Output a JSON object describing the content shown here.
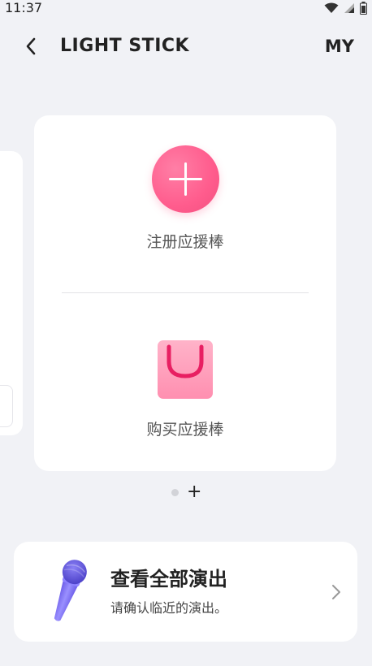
{
  "status_bar": {
    "time": "11:37"
  },
  "header": {
    "title": "LIGHT STICK",
    "my_label": "MY"
  },
  "main_card": {
    "register_label": "注册应援棒",
    "buy_label": "购买应援棒"
  },
  "pager": {
    "add_symbol": "+"
  },
  "concert_card": {
    "title": "查看全部演出",
    "subtitle": "请确认临近的演出。"
  },
  "colors": {
    "background": "#f1f2f6",
    "accent_pink": "#ff5c8d",
    "mic_purple": "#7b6cf0"
  },
  "icons": [
    "wifi-icon",
    "signal-icon",
    "battery-icon",
    "back-arrow-icon",
    "plus-icon",
    "shopping-bag-icon",
    "microphone-icon",
    "chevron-right-icon"
  ]
}
